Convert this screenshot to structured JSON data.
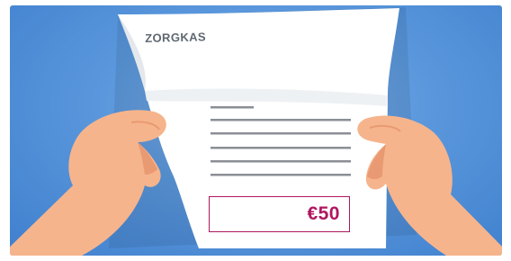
{
  "document": {
    "brand": "ZORGKAS",
    "amount": "€50"
  },
  "colors": {
    "background": "#5a97dc",
    "paper": "#ffffff",
    "skin": "#f6b48c",
    "skin_shadow": "#e99a72",
    "line": "#8a8f95",
    "accent": "#b0165f"
  },
  "icons": {
    "hands": "hands-holding-letter-icon"
  }
}
